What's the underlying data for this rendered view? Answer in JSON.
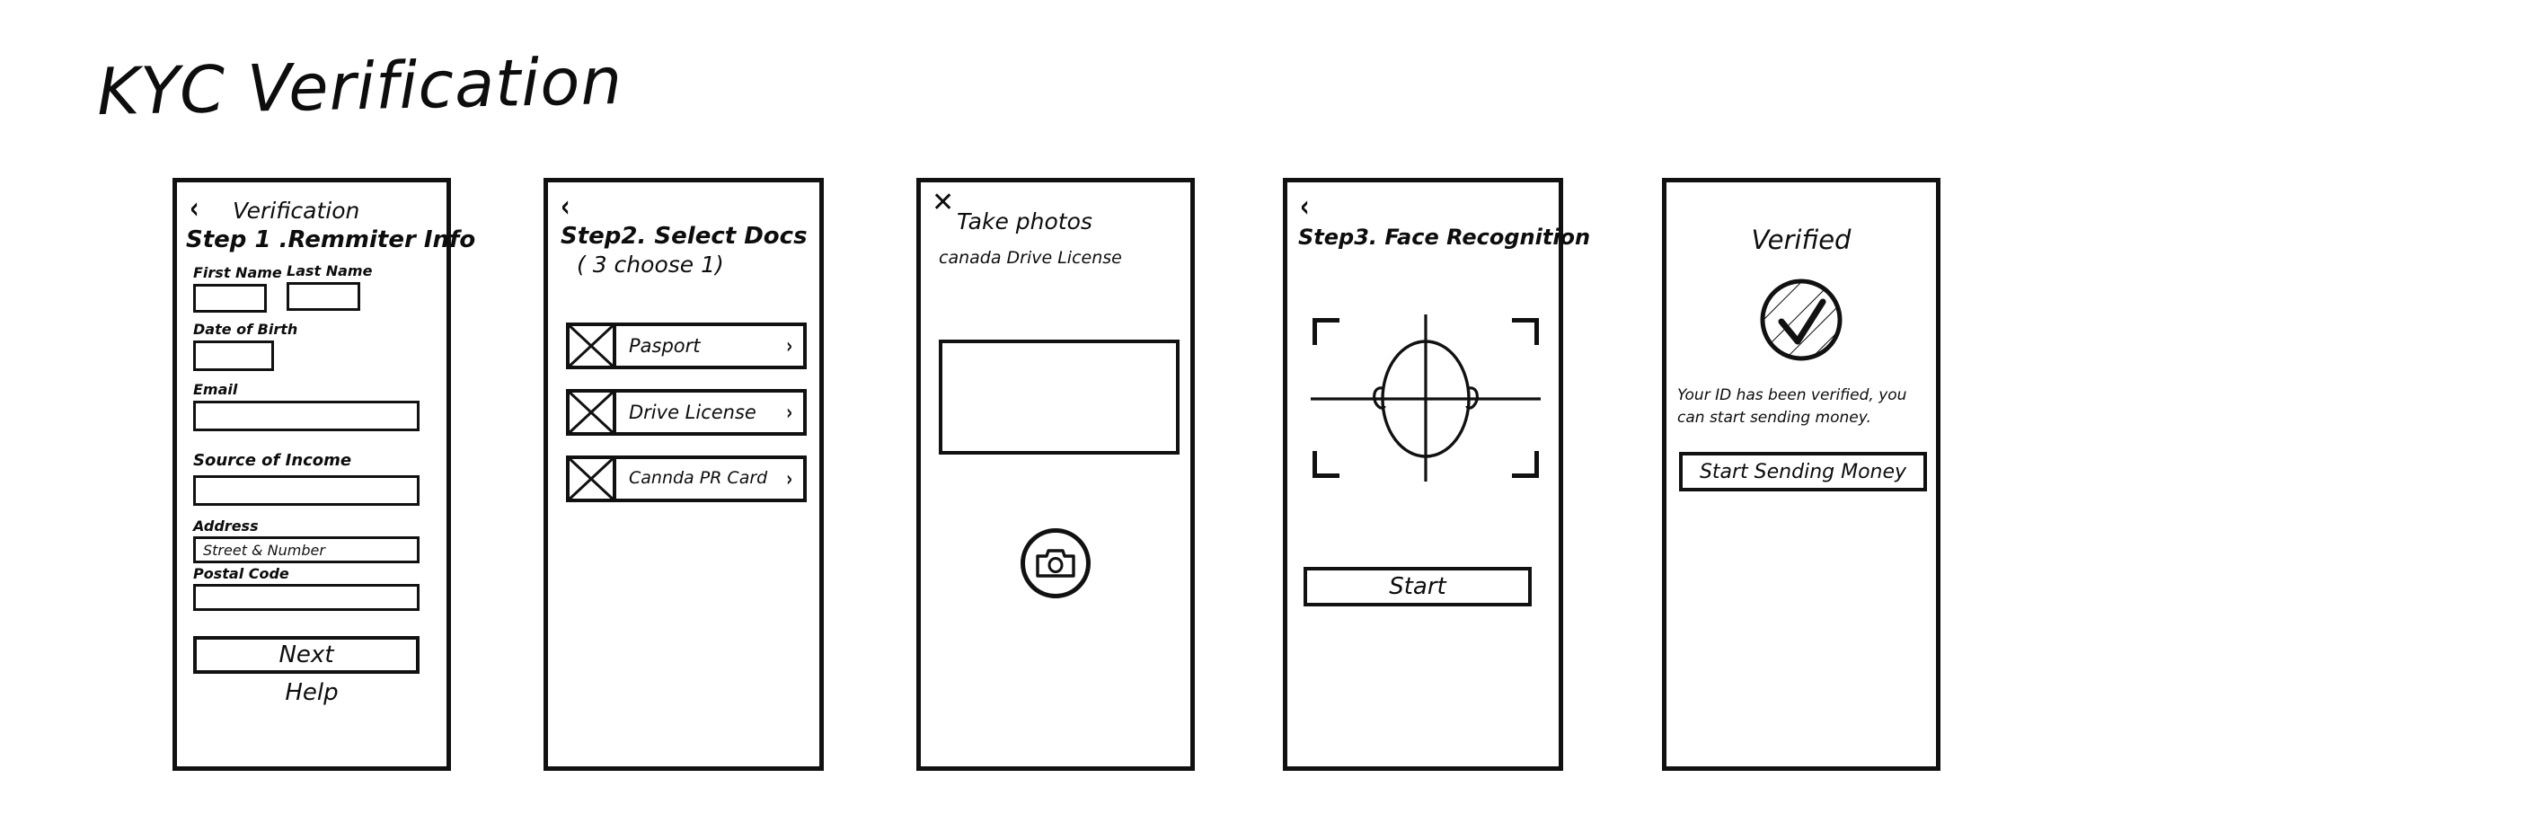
{
  "page": {
    "title": "KYC Verification"
  },
  "screens": [
    {
      "id": "remitter-info",
      "back_icon": "‹",
      "header": "Verification",
      "step_title": "Step 1 .Remmiter Info",
      "fields": [
        {
          "label": "First Name",
          "value": "",
          "placeholder": ""
        },
        {
          "label": "Last Name",
          "value": "",
          "placeholder": ""
        },
        {
          "label": "Date of Birth",
          "value": "",
          "placeholder": ""
        },
        {
          "label": "Email",
          "value": "",
          "placeholder": ""
        },
        {
          "label": "Source of Income",
          "value": "",
          "placeholder": ""
        },
        {
          "label": "Address",
          "value": "",
          "placeholder": "Street & Number"
        },
        {
          "label": "Postal Code",
          "value": "",
          "placeholder": ""
        }
      ],
      "next_button": "Next",
      "help_link": "Help"
    },
    {
      "id": "select-docs",
      "back_icon": "‹",
      "step_title": "Step2. Select Docs",
      "step_sub": "( 3 choose 1)",
      "docs": [
        {
          "label": "Pasport",
          "chevron": "›"
        },
        {
          "label": "Drive License",
          "chevron": "›"
        },
        {
          "label": "Cannda PR Card",
          "chevron": "›"
        }
      ]
    },
    {
      "id": "take-photos",
      "close_icon": "✕",
      "title": "Take photos",
      "subtitle": "canada Drive License",
      "shutter_label": "camera-shutter"
    },
    {
      "id": "face-recognition",
      "back_icon": "‹",
      "step_title": "Step3.  Face Recognition",
      "start_button": "Start"
    },
    {
      "id": "verified",
      "title": "Verified",
      "message": "Your ID has been verified, you can start sending money.",
      "cta_button": "Start Sending Money"
    }
  ],
  "colors": {
    "ink": "#111111",
    "paper": "#ffffff"
  }
}
